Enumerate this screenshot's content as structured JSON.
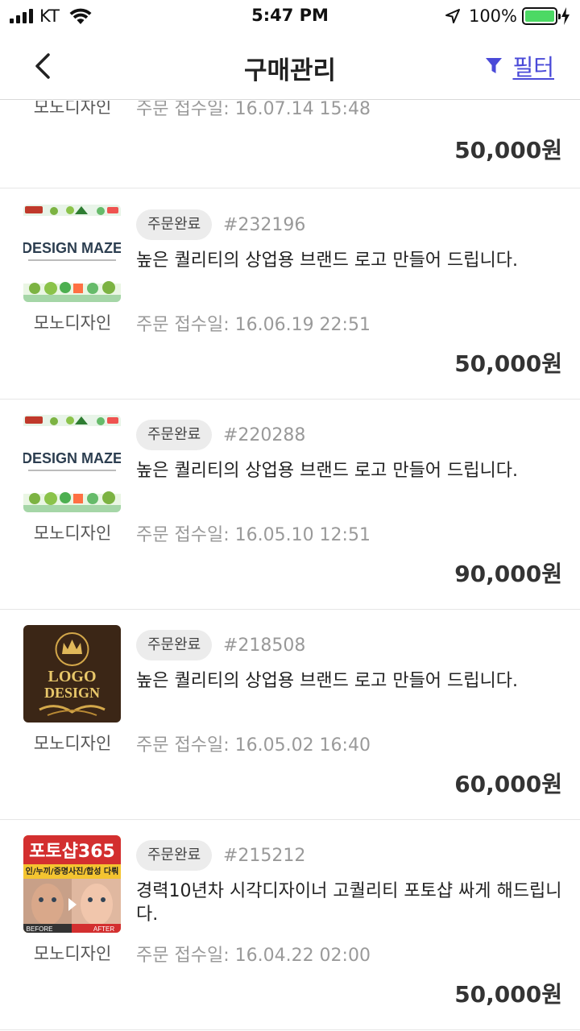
{
  "status_bar": {
    "carrier": "KT",
    "time": "5:47 PM",
    "battery": "100%",
    "battery_level": 1.0
  },
  "nav": {
    "title": "구매관리",
    "back_icon": "chevron-left-icon",
    "filter_icon": "funnel-icon",
    "filter_label": "필터"
  },
  "orders": [
    {
      "seller": "모노디자인",
      "date": "주문 접수일: 16.07.14 15:48",
      "price": "50,000원"
    },
    {
      "status": "주문완료",
      "order_no": "#232196",
      "title": "높은 퀄리티의 상업용 브랜드 로고 만들어 드립니다.",
      "seller": "모노디자인",
      "date": "주문 접수일: 16.06.19 22:51",
      "price": "50,000원",
      "thumb_text": "DESIGN MAZE"
    },
    {
      "status": "주문완료",
      "order_no": "#220288",
      "title": "높은 퀄리티의 상업용 브랜드 로고 만들어 드립니다.",
      "seller": "모노디자인",
      "date": "주문 접수일: 16.05.10 12:51",
      "price": "90,000원",
      "thumb_text": "DESIGN MAZE"
    },
    {
      "status": "주문완료",
      "order_no": "#218508",
      "title": "높은 퀄리티의 상업용 브랜드 로고 만들어 드립니다.",
      "seller": "모노디자인",
      "date": "주문 접수일: 16.05.02 16:40",
      "price": "60,000원",
      "thumb_line1": "LOGO",
      "thumb_line2": "DESIGN"
    },
    {
      "status": "주문완료",
      "order_no": "#215212",
      "title": "경력10년차 시각디자이너 고퀄리티 포토샵 싸게 해드립니다.",
      "seller": "모노디자인",
      "date": "주문 접수일: 16.04.22 02:00",
      "price": "50,000원",
      "thumb_heading": "포토샵365",
      "thumb_sub": "인/누끼/증명사진/합성 다뤄",
      "thumb_before": "BEFORE",
      "thumb_after": "AFTER"
    }
  ],
  "colors": {
    "accent": "#4a4ad8",
    "battery": "#4cd964"
  }
}
